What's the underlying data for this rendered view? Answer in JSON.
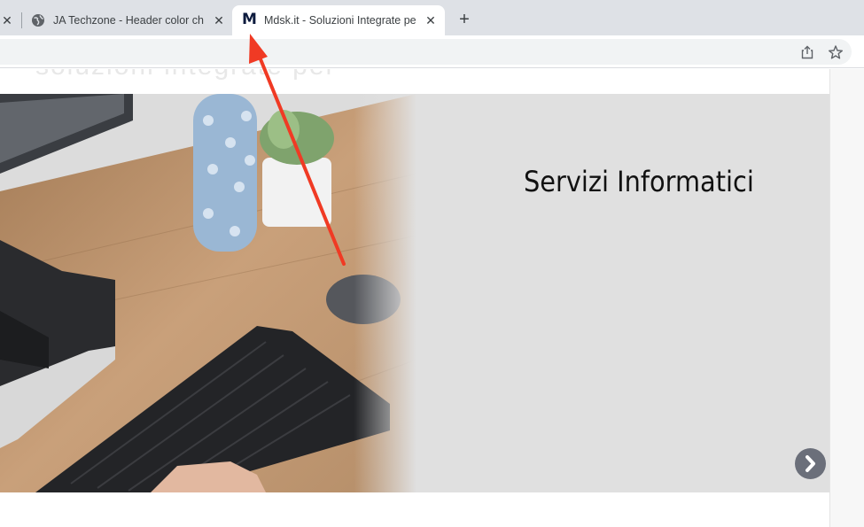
{
  "tabs": [
    {
      "title": "",
      "active": false
    },
    {
      "title": "JA Techzone - Header color ch",
      "active": false
    },
    {
      "title": "Mdsk.it - Soluzioni Integrate pe",
      "active": true,
      "favicon_letter": "M"
    }
  ],
  "tab_close_glyph": "✕",
  "new_tab_glyph": "+",
  "toolbar": {
    "share_icon": "share-icon",
    "bookmark_icon": "star-icon"
  },
  "page": {
    "ghost_text": "soluzioni integrate per",
    "hero": {
      "title": "Servizi Informatici",
      "next_icon": "chevron-right-icon"
    }
  },
  "annotation": {
    "type": "red arrow",
    "color": "#f03a24",
    "points_to": "active tab favicon"
  },
  "colors": {
    "tabstrip_bg": "#dee1e6",
    "hero_bg": "#e0e0e0",
    "next_button": "#6b6f7a",
    "favicon_m": "#0d1b3e"
  }
}
